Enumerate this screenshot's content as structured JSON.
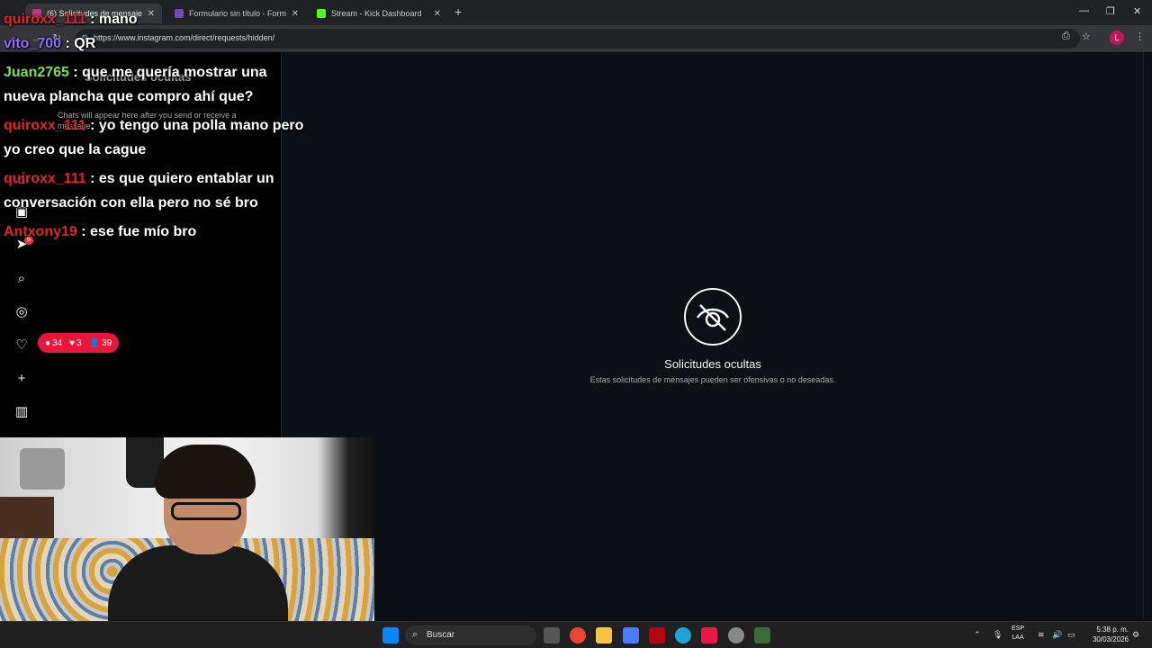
{
  "browser": {
    "tabs": [
      {
        "title": "(6) Solicitudes de mensajes • Inst",
        "active": true,
        "icon_color": "#c13584"
      },
      {
        "title": "Formulario sin título - Formulari",
        "active": false,
        "icon_color": "#7248b9"
      },
      {
        "title": "Stream - Kick Dashboard",
        "active": false,
        "icon_color": "#53fc18"
      }
    ],
    "new_tab": "+",
    "url": "https://www.instagram.com/direct/requests/hidden/",
    "profile_initial": "L"
  },
  "instagram": {
    "list_title": "Solicitudes ocultas",
    "empty_text": "Chats will appear here after you send or receive a message.",
    "notification_count": "6",
    "hidden_title": "Solicitudes ocultas",
    "hidden_subtitle": "Estas solicitudes de mensajes pueden ser ofensivas o no deseadas."
  },
  "chat": [
    {
      "user": "quiroxx_111",
      "text": " : mano",
      "color": "red"
    },
    {
      "user": "vito_700",
      "text": " : QR",
      "color": "violet"
    },
    {
      "user": "Juan2765",
      "text": " : que me quería mostrar una nueva plancha que compro ahí que?",
      "color": "green"
    },
    {
      "user": "quiroxx_111",
      "text": " : yo tengo una polla mano pero yo creo que la cague",
      "color": "red"
    },
    {
      "user": "quiroxx_111",
      "text": " : es que quiero entablar un conversación con ella pero no sé bro",
      "color": "red"
    },
    {
      "user": "Antxony19",
      "text": " : ese fue mío bro",
      "color": "red"
    }
  ],
  "stream_stats": {
    "comments": "34",
    "likes": "3",
    "viewers": "39"
  },
  "taskbar": {
    "search_label": "Buscar",
    "lang_top": "ESP",
    "lang_bottom": "LAA",
    "time": "5:38 p. m.",
    "date": "30/03/2026"
  }
}
